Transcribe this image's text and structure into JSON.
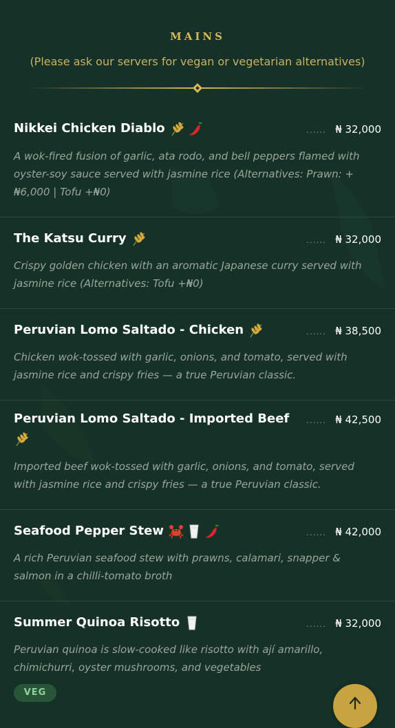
{
  "section": {
    "title": "MAINS",
    "subtitle": "(Please ask our servers for vegan or vegetarian alternatives)"
  },
  "items": [
    {
      "name": "Nikkei Chicken Diablo",
      "icons": [
        "rice-icon",
        "chili-icon"
      ],
      "price": "₦ 32,000",
      "description": "A wok-fired fusion of garlic, ata rodo, and bell peppers flamed with oyster-soy sauce served with jasmine rice (Alternatives: Prawn: + ₦6,000 | Tofu +₦0)"
    },
    {
      "name": "The Katsu Curry",
      "icons": [
        "rice-icon"
      ],
      "price": "₦ 32,000",
      "description": "Crispy golden chicken with an aromatic Japanese curry served with jasmine rice (Alternatives: Tofu +₦0)"
    },
    {
      "name": "Peruvian Lomo Saltado - Chicken",
      "icons": [
        "rice-icon"
      ],
      "price": "₦ 38,500",
      "description": "Chicken wok-tossed with garlic, onions, and tomato, served with jasmine rice and crispy fries — a true Peruvian classic."
    },
    {
      "name": "Peruvian Lomo Saltado - Imported Beef",
      "icons": [
        "rice-icon"
      ],
      "price": "₦ 42,500",
      "description": "Imported beef wok-tossed with garlic, onions, and tomato, served with jasmine rice and crispy fries — a true Peruvian classic."
    },
    {
      "name": "Seafood Pepper Stew",
      "icons": [
        "crab-icon",
        "milk-icon",
        "chili-icon"
      ],
      "price": "₦ 42,000",
      "description": "A rich Peruvian seafood stew with prawns, calamari, snapper & salmon in a chilli-tomato broth"
    },
    {
      "name": "Summer Quinoa Risotto",
      "icons": [
        "milk-icon"
      ],
      "price": "₦ 32,000",
      "description": "Peruvian quinoa is slow-cooked like risotto with ají amarillo, chimichurri, oyster mushrooms, and vegetables",
      "badge": "VEG"
    }
  ],
  "dots": "......",
  "colors": {
    "background": "#163127",
    "gold": "#d9b85a",
    "muted_text": "#9aa69d",
    "veg_badge": "#285538"
  },
  "fab": {
    "icon": "up-arrow-icon"
  }
}
